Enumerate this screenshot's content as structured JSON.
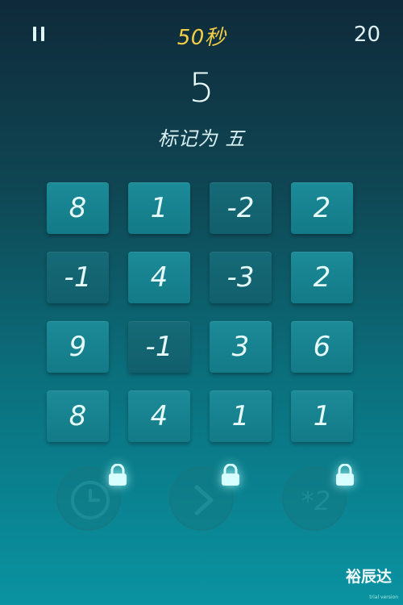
{
  "header": {
    "timer": "50秒",
    "score": "20"
  },
  "target": {
    "number": "5",
    "instruction": "标记为 五"
  },
  "grid": {
    "rows": [
      [
        "8",
        "1",
        "-2",
        "2"
      ],
      [
        "-1",
        "4",
        "-3",
        "2"
      ],
      [
        "9",
        "-1",
        "3",
        "6"
      ],
      [
        "8",
        "4",
        "1",
        "1"
      ]
    ]
  },
  "powerups": [
    {
      "icon": "clock-icon",
      "locked": true
    },
    {
      "icon": "skip-arrow-icon",
      "locked": true
    },
    {
      "icon": "multiply-two-icon",
      "label": "*2",
      "locked": true
    }
  ],
  "watermark": {
    "text": "裕辰达",
    "subtext": "trial version"
  },
  "colors": {
    "timer": "#f2cf45",
    "tile": "#1c8b98",
    "lock_glow": "#aaffff"
  }
}
